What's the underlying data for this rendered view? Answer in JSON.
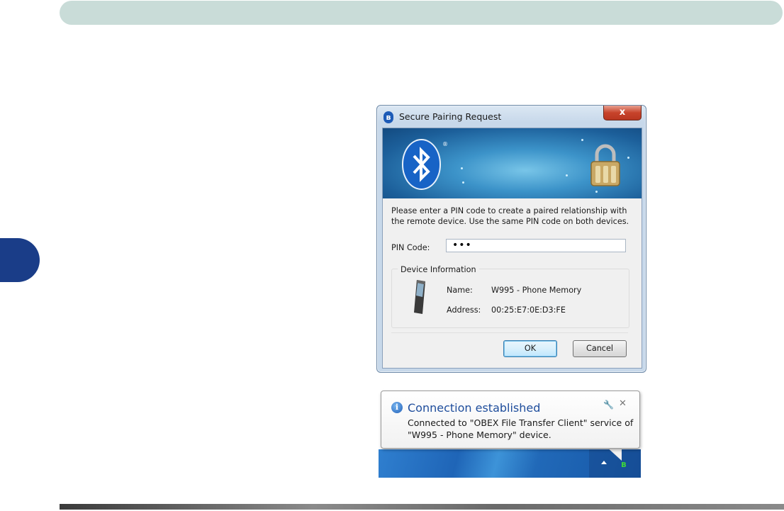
{
  "dialog": {
    "title": "Secure Pairing Request",
    "close_glyph": "x",
    "registered_mark": "®",
    "message": "Please enter a PIN code to create a paired relationship with the remote device. Use the same PIN code on both devices.",
    "pin_label": "PIN Code:",
    "pin_value": "•••",
    "device_info_title": "Device Information",
    "name_label": "Name:",
    "name_value": "W995 - Phone Memory",
    "address_label": "Address:",
    "address_value": "00:25:E7:0E:D3:FE",
    "ok_label": "OK",
    "cancel_label": "Cancel"
  },
  "notification": {
    "icon_glyph": "i",
    "title": "Connection established",
    "body": "Connected to \"OBEX File Transfer Client\" service of \"W995 - Phone Memory\" device.",
    "tool_glyph": "🔧",
    "close_glyph": "✕"
  },
  "colors": {
    "header_bar": "#c9dcd8",
    "side_tab": "#1a3d88",
    "notification_title": "#1e4d9c"
  }
}
